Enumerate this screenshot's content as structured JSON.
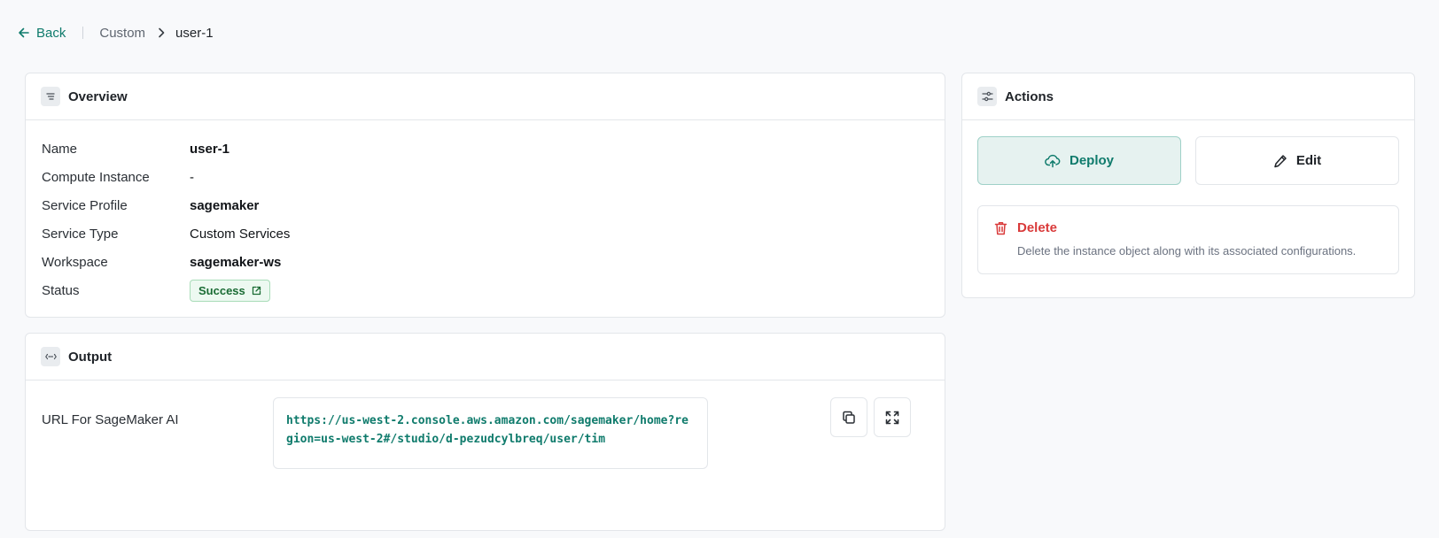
{
  "breadcrumb": {
    "back_label": "Back",
    "parent": "Custom",
    "current": "user-1"
  },
  "overview": {
    "title": "Overview",
    "rows": [
      {
        "label": "Name",
        "value": "user-1"
      },
      {
        "label": "Compute Instance",
        "value": "-"
      },
      {
        "label": "Service Profile",
        "value": "sagemaker"
      },
      {
        "label": "Service Type",
        "value": "Custom Services"
      },
      {
        "label": "Workspace",
        "value": "sagemaker-ws"
      },
      {
        "label": "Status",
        "value": "Success"
      }
    ]
  },
  "output": {
    "title": "Output",
    "label": "URL For SageMaker AI",
    "url": "https://us-west-2.console.aws.amazon.com/sagemaker/home?region=us-west-2#/studio/d-pezudcylbreq/user/tim"
  },
  "actions": {
    "title": "Actions",
    "deploy_label": "Deploy",
    "edit_label": "Edit",
    "delete_label": "Delete",
    "delete_description": "Delete the instance object along with its associated configurations."
  },
  "icons": {
    "back": "arrow-left-icon",
    "chevron": "chevron-right-icon",
    "overview": "align-lines-icon",
    "output": "arrows-horizontal-icon",
    "actions": "sliders-icon",
    "status_link": "external-link-icon",
    "copy": "copy-icon",
    "expand": "expand-icon",
    "deploy": "cloud-upload-icon",
    "edit": "pencil-icon",
    "delete": "trash-icon"
  },
  "colors": {
    "accent": "#0f7b6c",
    "danger": "#d93a3a",
    "success": "#1a6b34",
    "background": "#f8f9fb"
  }
}
